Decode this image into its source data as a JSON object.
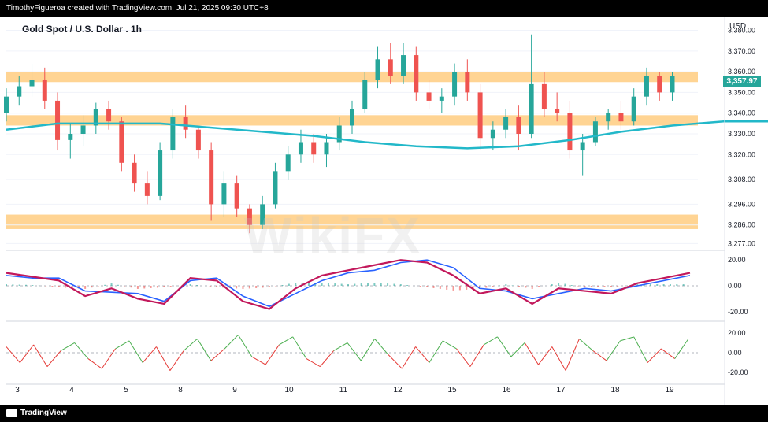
{
  "header": {
    "attribution": "TimothyFigueroa created with TradingView.com, Jul 21, 2025 09:30 UTC+8"
  },
  "footer": {
    "brand": "TradingView"
  },
  "watermark_text": "WikiFX",
  "chart_data": [
    {
      "type": "candlestick",
      "title": "Gold Spot / U.S. Dollar . 1h",
      "currency": "USD",
      "last_price_label": "3,357.97",
      "y_ticks": [
        {
          "value": 3380,
          "label": "3,380.00"
        },
        {
          "value": 3370,
          "label": "3,370.00"
        },
        {
          "value": 3360,
          "label": "3,360.00"
        },
        {
          "value": 3350,
          "label": "3,350.00"
        },
        {
          "value": 3340,
          "label": "3,340.00"
        },
        {
          "value": 3330,
          "label": "3,330.00"
        },
        {
          "value": 3320,
          "label": "3,320.00"
        },
        {
          "value": 3308,
          "label": "3,308.00"
        },
        {
          "value": 3296,
          "label": "3,296.00"
        },
        {
          "value": 3286,
          "label": "3,286.00"
        },
        {
          "value": 3277,
          "label": "3,277.00"
        }
      ],
      "ylim": [
        3276,
        3384
      ],
      "x_ticks": [
        "3",
        "4",
        "5",
        "8",
        "9",
        "10",
        "11",
        "12",
        "15",
        "16",
        "17",
        "18",
        "19"
      ],
      "zones": [
        {
          "from": 3355,
          "to": 3360,
          "color": "#ffcc80"
        },
        {
          "from": 3334,
          "to": 3339,
          "color": "#ffcc80"
        },
        {
          "from": 3284,
          "to": 3291,
          "color": "#ffcc80"
        }
      ],
      "moving_average": {
        "color": "#22b8c9",
        "points": [
          [
            0,
            3332
          ],
          [
            2,
            3335
          ],
          [
            4,
            3335
          ],
          [
            6,
            3335
          ],
          [
            8,
            3333
          ],
          [
            10,
            3331
          ],
          [
            12,
            3329
          ],
          [
            14,
            3326
          ],
          [
            16,
            3324
          ],
          [
            18,
            3323
          ],
          [
            20,
            3324
          ],
          [
            22,
            3327
          ],
          [
            24,
            3331
          ],
          [
            26,
            3334
          ],
          [
            28,
            3336
          ],
          [
            30,
            3336
          ],
          [
            32,
            3336
          ],
          [
            34,
            3337
          ],
          [
            36,
            3337
          ],
          [
            38,
            3337
          ],
          [
            40,
            3337
          ],
          [
            42,
            3338
          ],
          [
            44,
            3339
          ],
          [
            46,
            3339
          ]
        ]
      },
      "candles": [
        [
          0,
          3340,
          3352,
          3336,
          3348
        ],
        [
          0.5,
          3348,
          3358,
          3344,
          3353
        ],
        [
          1,
          3353,
          3364,
          3348,
          3356
        ],
        [
          1.5,
          3356,
          3362,
          3342,
          3346
        ],
        [
          2,
          3346,
          3350,
          3322,
          3327
        ],
        [
          2.5,
          3327,
          3335,
          3318,
          3330
        ],
        [
          3,
          3330,
          3339,
          3324,
          3334
        ],
        [
          3.5,
          3334,
          3345,
          3330,
          3342
        ],
        [
          4,
          3342,
          3346,
          3332,
          3336
        ],
        [
          4.5,
          3336,
          3338,
          3312,
          3316
        ],
        [
          5,
          3316,
          3320,
          3302,
          3306
        ],
        [
          5.5,
          3306,
          3312,
          3296,
          3300
        ],
        [
          6,
          3300,
          3326,
          3298,
          3322
        ],
        [
          6.5,
          3322,
          3342,
          3318,
          3338
        ],
        [
          7,
          3338,
          3344,
          3328,
          3332
        ],
        [
          7.5,
          3332,
          3334,
          3318,
          3322
        ],
        [
          8,
          3322,
          3326,
          3288,
          3296
        ],
        [
          8.5,
          3296,
          3312,
          3290,
          3306
        ],
        [
          9,
          3306,
          3310,
          3290,
          3294
        ],
        [
          9.5,
          3294,
          3296,
          3282,
          3286
        ],
        [
          10,
          3286,
          3300,
          3284,
          3296
        ],
        [
          10.5,
          3296,
          3316,
          3294,
          3312
        ],
        [
          11,
          3312,
          3324,
          3308,
          3320
        ],
        [
          11.5,
          3320,
          3332,
          3316,
          3326
        ],
        [
          12,
          3326,
          3330,
          3316,
          3320
        ],
        [
          12.5,
          3320,
          3330,
          3314,
          3326
        ],
        [
          13,
          3326,
          3338,
          3322,
          3334
        ],
        [
          13.5,
          3334,
          3346,
          3330,
          3342
        ],
        [
          14,
          3342,
          3360,
          3340,
          3356
        ],
        [
          14.5,
          3356,
          3372,
          3352,
          3366
        ],
        [
          15,
          3366,
          3374,
          3354,
          3358
        ],
        [
          15.5,
          3358,
          3374,
          3354,
          3368
        ],
        [
          16,
          3368,
          3372,
          3346,
          3350
        ],
        [
          16.5,
          3350,
          3356,
          3342,
          3346
        ],
        [
          17,
          3346,
          3352,
          3340,
          3348
        ],
        [
          17.5,
          3348,
          3364,
          3344,
          3360
        ],
        [
          18,
          3360,
          3366,
          3346,
          3350
        ],
        [
          18.5,
          3350,
          3354,
          3322,
          3328
        ],
        [
          19,
          3328,
          3336,
          3322,
          3332
        ],
        [
          19.5,
          3332,
          3342,
          3328,
          3338
        ],
        [
          20,
          3338,
          3344,
          3322,
          3330
        ],
        [
          20.5,
          3330,
          3378,
          3328,
          3354
        ],
        [
          21,
          3354,
          3360,
          3338,
          3342
        ],
        [
          21.5,
          3342,
          3350,
          3336,
          3340
        ],
        [
          22,
          3340,
          3346,
          3318,
          3322
        ],
        [
          22.5,
          3322,
          3330,
          3310,
          3326
        ],
        [
          23,
          3326,
          3338,
          3324,
          3336
        ],
        [
          23.5,
          3336,
          3342,
          3332,
          3340
        ],
        [
          24,
          3340,
          3346,
          3332,
          3336
        ],
        [
          24.5,
          3336,
          3352,
          3334,
          3348
        ],
        [
          25,
          3348,
          3362,
          3344,
          3358
        ],
        [
          25.5,
          3358,
          3360,
          3346,
          3350
        ],
        [
          26,
          3350,
          3360,
          3346,
          3358
        ]
      ],
      "x_max": 27
    },
    {
      "type": "macd",
      "y_ticks": [
        {
          "value": 20,
          "label": "20.00"
        },
        {
          "value": 0,
          "label": "0.00"
        },
        {
          "value": -20,
          "label": "-20.00"
        }
      ],
      "ylim": [
        -25,
        25
      ],
      "series": [
        {
          "color": "#2962ff",
          "values": [
            [
              0,
              8
            ],
            [
              1,
              6
            ],
            [
              2,
              6
            ],
            [
              3,
              -4
            ],
            [
              4,
              -5
            ],
            [
              5,
              -6
            ],
            [
              6,
              -12
            ],
            [
              7,
              4
            ],
            [
              8,
              6
            ],
            [
              9,
              -8
            ],
            [
              10,
              -16
            ],
            [
              11,
              -6
            ],
            [
              12,
              4
            ],
            [
              13,
              10
            ],
            [
              14,
              12
            ],
            [
              15,
              18
            ],
            [
              16,
              20
            ],
            [
              17,
              14
            ],
            [
              18,
              -2
            ],
            [
              19,
              -4
            ],
            [
              20,
              -10
            ],
            [
              21,
              -6
            ],
            [
              22,
              -2
            ],
            [
              23,
              -4
            ],
            [
              24,
              0
            ],
            [
              25,
              4
            ],
            [
              26,
              8
            ]
          ]
        },
        {
          "color": "#c2185b",
          "values": [
            [
              0,
              10
            ],
            [
              1,
              7
            ],
            [
              2,
              4
            ],
            [
              3,
              -8
            ],
            [
              4,
              -2
            ],
            [
              5,
              -10
            ],
            [
              6,
              -14
            ],
            [
              7,
              6
            ],
            [
              8,
              4
            ],
            [
              9,
              -12
            ],
            [
              10,
              -18
            ],
            [
              11,
              -2
            ],
            [
              12,
              8
            ],
            [
              13,
              12
            ],
            [
              14,
              16
            ],
            [
              15,
              20
            ],
            [
              16,
              18
            ],
            [
              17,
              8
            ],
            [
              18,
              -6
            ],
            [
              19,
              -2
            ],
            [
              20,
              -14
            ],
            [
              21,
              -2
            ],
            [
              22,
              -4
            ],
            [
              23,
              -6
            ],
            [
              24,
              2
            ],
            [
              25,
              6
            ],
            [
              26,
              10
            ]
          ]
        }
      ]
    },
    {
      "type": "line",
      "y_ticks": [
        {
          "value": 20,
          "label": "20.00"
        },
        {
          "value": 0,
          "label": "0.00"
        },
        {
          "value": -20,
          "label": "-20.00"
        }
      ],
      "ylim": [
        -27,
        27
      ],
      "values": [
        6,
        -10,
        8,
        -14,
        2,
        10,
        -6,
        -16,
        4,
        12,
        -10,
        6,
        -18,
        2,
        14,
        -8,
        4,
        18,
        -4,
        -12,
        8,
        16,
        -6,
        -14,
        2,
        10,
        -8,
        14,
        -2,
        -16,
        6,
        -10,
        12,
        4,
        -14,
        8,
        16,
        -4,
        10,
        -12,
        6,
        -18,
        14,
        2,
        -8,
        12,
        16,
        -10,
        4,
        -6,
        14
      ]
    }
  ]
}
